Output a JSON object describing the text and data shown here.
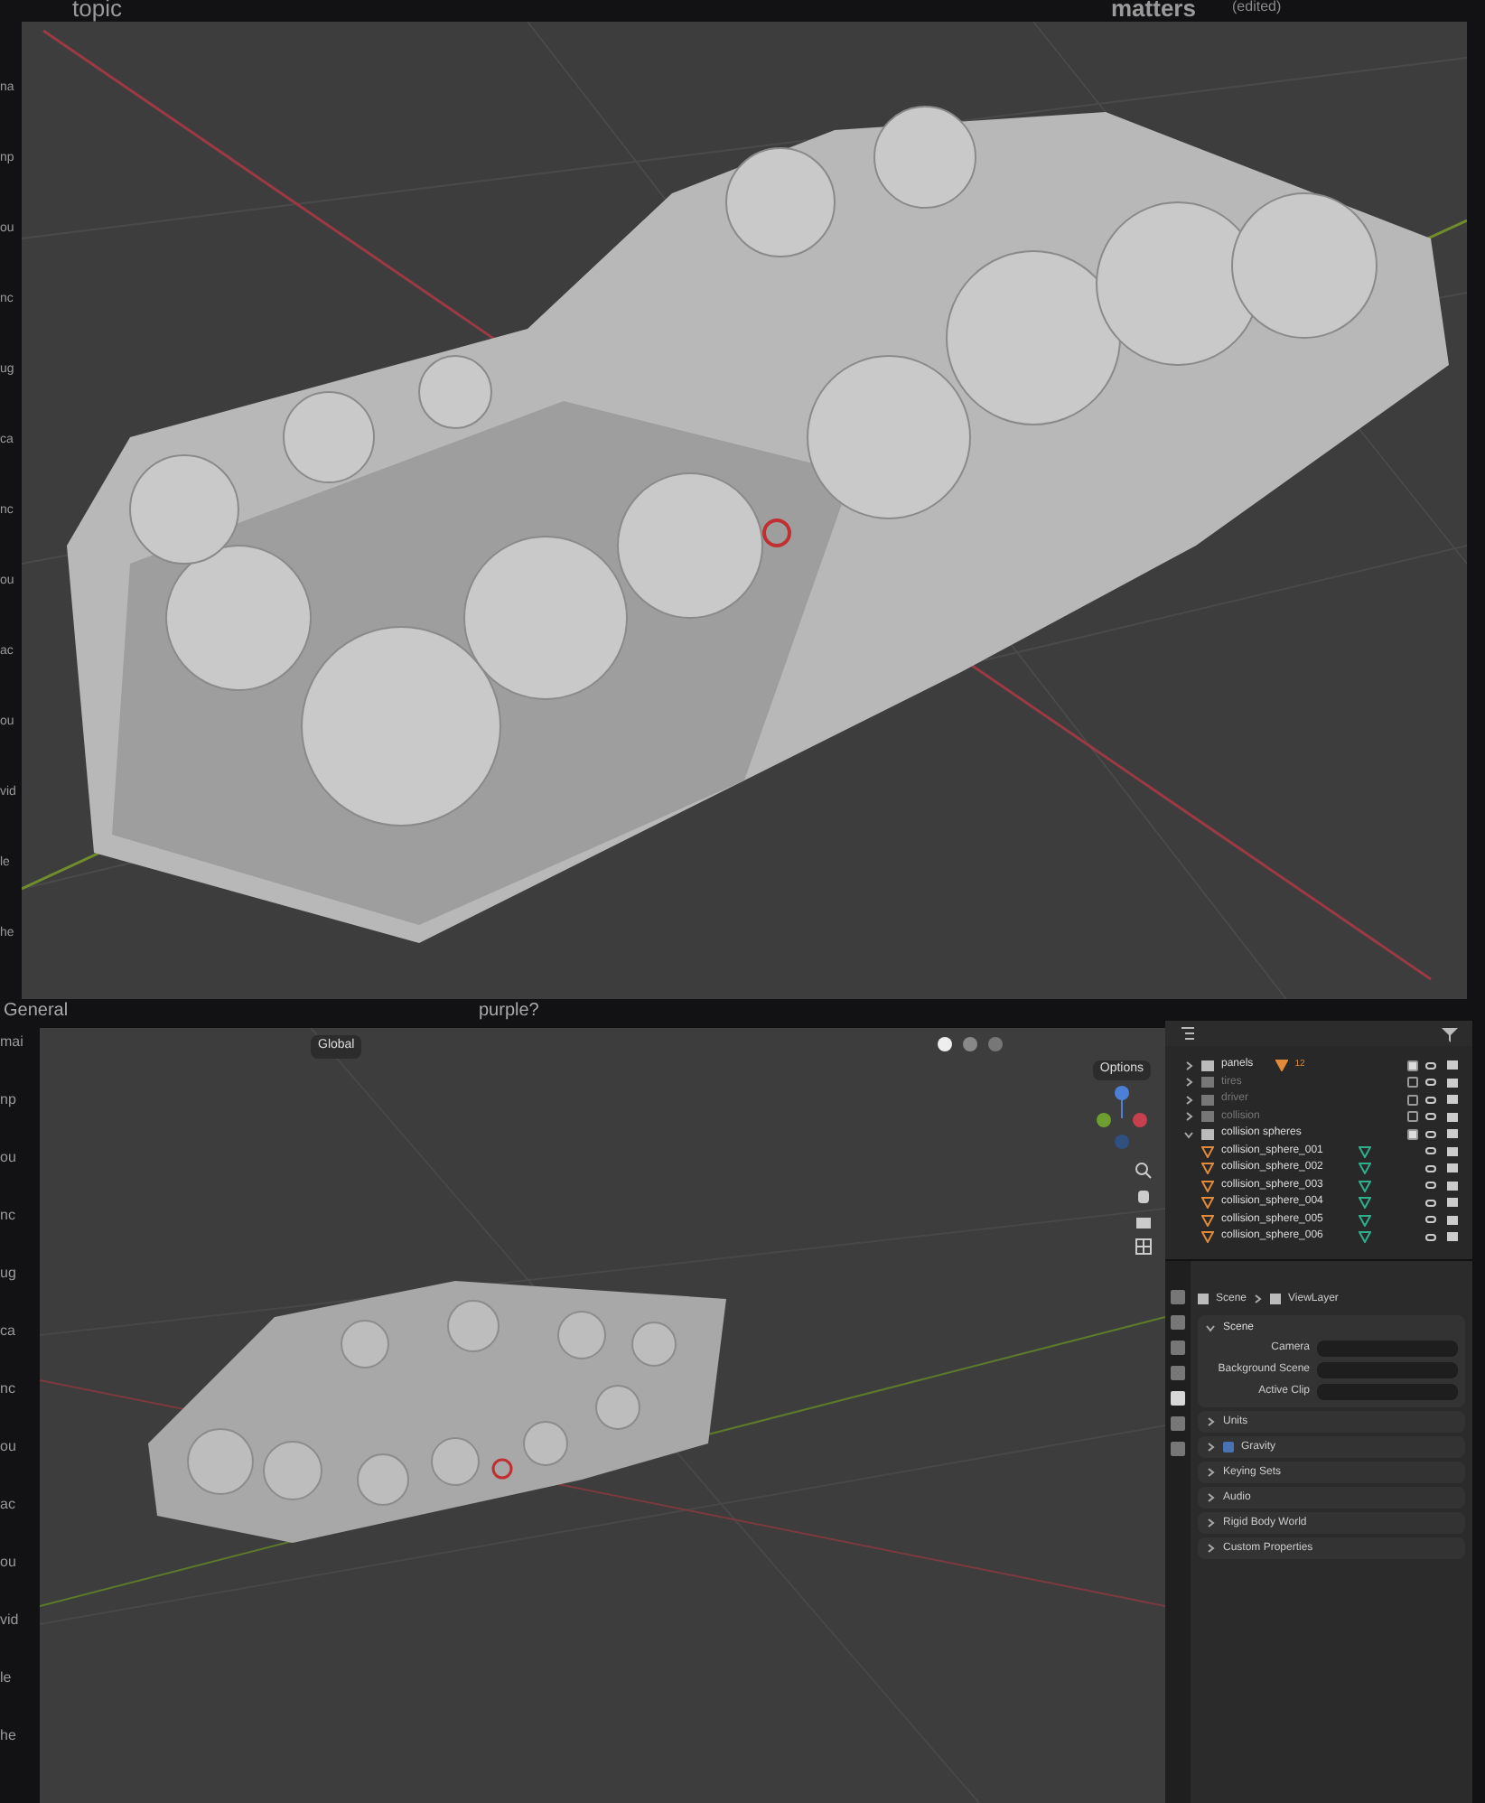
{
  "background_chat": {
    "fragments_top": [
      "topic",
      "matters",
      "(edited)"
    ],
    "fragments_middle": [
      "General",
      "purple?"
    ],
    "left_edge_upper": [
      "na",
      "np",
      "ou",
      "nc",
      "ug",
      "ca",
      "nc",
      "ou",
      "ac",
      "ou",
      "vid",
      "le",
      "he"
    ],
    "left_edge_lower": [
      "mai",
      "np",
      "ou",
      "nc",
      "ug",
      "ca",
      "nc",
      "ou",
      "ac",
      "ou",
      "vid",
      "le",
      "he"
    ]
  },
  "viewport_header": {
    "orientation": "Global",
    "options": "Options"
  },
  "outliner": {
    "rows": [
      {
        "kind": "collection",
        "name": "panels",
        "checked": true,
        "expanded": false,
        "badge": "12"
      },
      {
        "kind": "collection",
        "name": "tires",
        "checked": false,
        "expanded": false
      },
      {
        "kind": "collection",
        "name": "driver",
        "checked": false,
        "expanded": false
      },
      {
        "kind": "collection",
        "name": "collision",
        "checked": false,
        "expanded": false
      },
      {
        "kind": "collection",
        "name": "collision spheres",
        "checked": true,
        "expanded": true
      },
      {
        "kind": "object",
        "name": "collision_sphere_001"
      },
      {
        "kind": "object",
        "name": "collision_sphere_002"
      },
      {
        "kind": "object",
        "name": "collision_sphere_003"
      },
      {
        "kind": "object",
        "name": "collision_sphere_004"
      },
      {
        "kind": "object",
        "name": "collision_sphere_005"
      },
      {
        "kind": "object",
        "name": "collision_sphere_006"
      }
    ]
  },
  "properties": {
    "breadcrumb": [
      "Scene",
      "ViewLayer"
    ],
    "tabs": [
      {
        "selected": false
      },
      {
        "selected": false
      },
      {
        "selected": false
      },
      {
        "selected": false
      },
      {
        "selected": true
      },
      {
        "selected": false
      },
      {
        "selected": false
      }
    ],
    "scene_panel": {
      "title": "Scene",
      "expanded": true,
      "fields": [
        {
          "label": "Camera"
        },
        {
          "label": "Background Scene"
        },
        {
          "label": "Active Clip"
        }
      ]
    },
    "panels": [
      {
        "title": "Units",
        "kind": "plain"
      },
      {
        "title": "Gravity",
        "kind": "checkbox",
        "checked": true
      },
      {
        "title": "Keying Sets",
        "kind": "plain"
      },
      {
        "title": "Audio",
        "kind": "plain"
      },
      {
        "title": "Rigid Body World",
        "kind": "plain"
      },
      {
        "title": "Custom Properties",
        "kind": "plain"
      }
    ]
  }
}
